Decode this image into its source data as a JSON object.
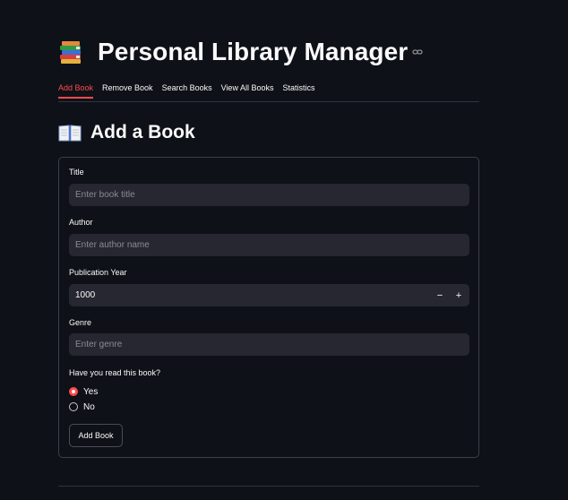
{
  "header": {
    "title": "Personal Library Manager",
    "title_icon": "books-emoji",
    "link_icon": "link-icon"
  },
  "tabs": [
    {
      "label": "Add Book",
      "active": true
    },
    {
      "label": "Remove Book",
      "active": false
    },
    {
      "label": "Search Books",
      "active": false
    },
    {
      "label": "View All Books",
      "active": false
    },
    {
      "label": "Statistics",
      "active": false
    }
  ],
  "section": {
    "title": "Add a Book",
    "icon": "open-book-emoji"
  },
  "form": {
    "title_label": "Title",
    "title_placeholder": "Enter book title",
    "author_label": "Author",
    "author_placeholder": "Enter author name",
    "year_label": "Publication Year",
    "year_value": "1000",
    "year_minus": "−",
    "year_plus": "+",
    "genre_label": "Genre",
    "genre_placeholder": "Enter genre",
    "read_label": "Have you read this book?",
    "read_options": [
      {
        "label": "Yes",
        "selected": true
      },
      {
        "label": "No",
        "selected": false
      }
    ],
    "submit_label": "Add Book"
  },
  "colors": {
    "background": "#0e1117",
    "accent": "#ff4b4b",
    "input_bg": "#262730",
    "text": "#fafafa"
  }
}
